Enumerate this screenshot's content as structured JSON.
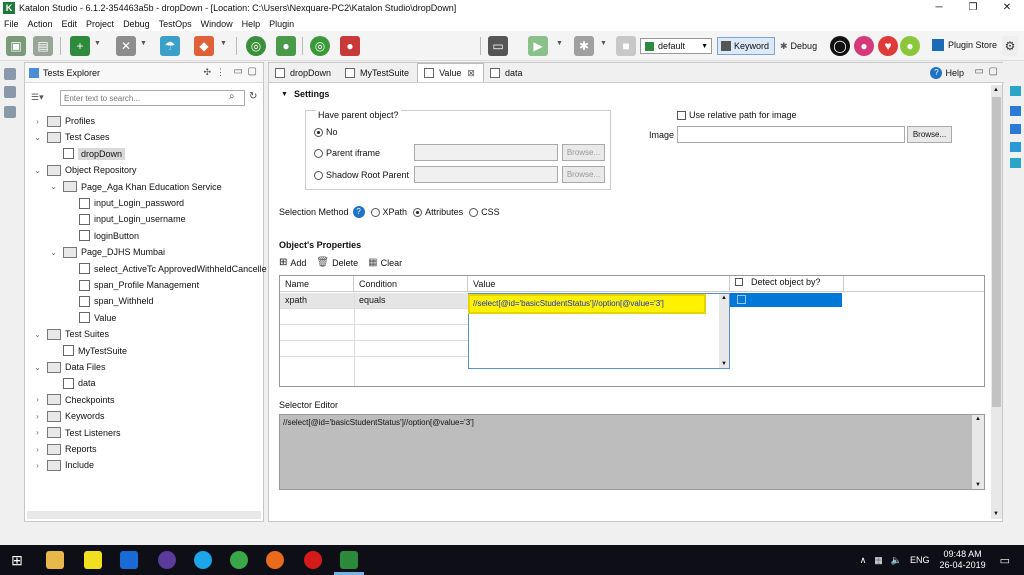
{
  "window": {
    "title": "Katalon Studio - 6.1.2-354463a5b - dropDown - [Location: C:\\Users\\Nexquare-PC2\\Katalon Studio\\dropDown]",
    "logo": "K",
    "minimize": "─",
    "restore": "❐",
    "close": "✕"
  },
  "menu": [
    "File",
    "Action",
    "Edit",
    "Project",
    "Debug",
    "TestOps",
    "Window",
    "Help",
    "Plugin"
  ],
  "toolbar": {
    "profile_select": "default",
    "keyword_label": "Keyword",
    "debug_label": "Debug",
    "plugin_store_label": "Plugin Store"
  },
  "explorer": {
    "title": "Tests Explorer",
    "search_placeholder": "Enter text to search...",
    "tree": [
      {
        "label": "Profiles",
        "level": 0,
        "type": "folder",
        "expanded": false
      },
      {
        "label": "Test Cases",
        "level": 0,
        "type": "folder",
        "expanded": true
      },
      {
        "label": "dropDown",
        "level": 1,
        "type": "file",
        "selected": true
      },
      {
        "label": "Object Repository",
        "level": 0,
        "type": "folder",
        "expanded": true
      },
      {
        "label": "Page_Aga Khan Education Service",
        "level": 1,
        "type": "folder",
        "expanded": true
      },
      {
        "label": "input_Login_password",
        "level": 2,
        "type": "file"
      },
      {
        "label": "input_Login_username",
        "level": 2,
        "type": "file"
      },
      {
        "label": "loginButton",
        "level": 2,
        "type": "file"
      },
      {
        "label": "Page_DJHS Mumbai",
        "level": 1,
        "type": "folder",
        "expanded": true
      },
      {
        "label": "select_ActiveTc ApprovedWithheldCancelle",
        "level": 2,
        "type": "file"
      },
      {
        "label": "span_Profile Management",
        "level": 2,
        "type": "file"
      },
      {
        "label": "span_Withheld",
        "level": 2,
        "type": "file"
      },
      {
        "label": "Value",
        "level": 2,
        "type": "file"
      },
      {
        "label": "Test Suites",
        "level": 0,
        "type": "folder",
        "expanded": true
      },
      {
        "label": "MyTestSuite",
        "level": 1,
        "type": "file"
      },
      {
        "label": "Data Files",
        "level": 0,
        "type": "folder",
        "expanded": true
      },
      {
        "label": "data",
        "level": 1,
        "type": "file"
      },
      {
        "label": "Checkpoints",
        "level": 0,
        "type": "folder",
        "expanded": false
      },
      {
        "label": "Keywords",
        "level": 0,
        "type": "folder",
        "expanded": false
      },
      {
        "label": "Test Listeners",
        "level": 0,
        "type": "folder",
        "expanded": false
      },
      {
        "label": "Reports",
        "level": 0,
        "type": "folder",
        "expanded": false
      },
      {
        "label": "Include",
        "level": 0,
        "type": "folder",
        "expanded": false
      }
    ]
  },
  "editor": {
    "tabs": [
      {
        "label": "dropDown",
        "active": false
      },
      {
        "label": "MyTestSuite",
        "active": false
      },
      {
        "label": "Value",
        "active": true
      },
      {
        "label": "data",
        "active": false
      }
    ],
    "help_label": "Help",
    "settings": {
      "section_title": "Settings",
      "parent_label": "Have parent object?",
      "parent_options": [
        "No",
        "Parent iframe",
        "Shadow Root Parent"
      ],
      "parent_selected": "No",
      "browse_label": "Browse...",
      "relative_path_label": "Use relative path for image",
      "image_label": "Image"
    },
    "selection_method": {
      "label": "Selection Method",
      "options": [
        "XPath",
        "Attributes",
        "CSS"
      ],
      "selected": "Attributes"
    },
    "properties": {
      "title": "Object's Properties",
      "add_label": "Add",
      "delete_label": "Delete",
      "clear_label": "Clear",
      "columns": [
        "Name",
        "Condition",
        "Value",
        "Detect object by?"
      ],
      "rows": [
        {
          "name": "xpath",
          "condition": "equals",
          "value": "//select[@id='basicStudentStatus']//option[@value='3']"
        }
      ]
    },
    "selector_editor": {
      "title": "Selector Editor",
      "value": "//select[@id='basicStudentStatus']//option[@value='3']"
    }
  },
  "taskbar": {
    "lang": "ENG",
    "time": "09:48 AM",
    "date": "26-04-2019"
  },
  "colors": {
    "highlight_yellow": "#fff200",
    "selection_blue": "#0078d7",
    "selector_bg": "#bdbdbd"
  }
}
